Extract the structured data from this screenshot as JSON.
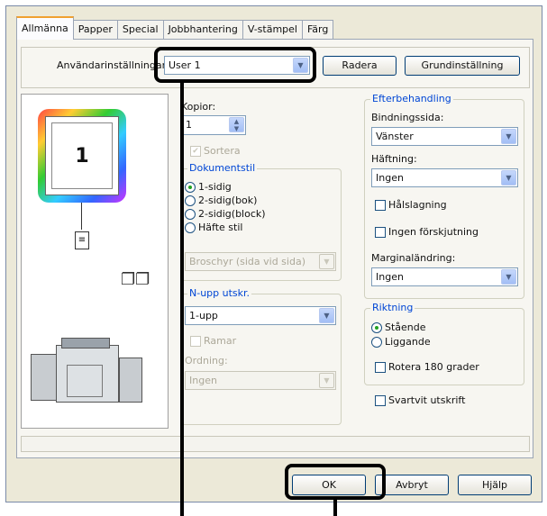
{
  "tabs": [
    "Allmänna",
    "Papper",
    "Special",
    "Jobbhantering",
    "V-stämpel",
    "Färg"
  ],
  "user_settings": {
    "label": "Användarinställningar",
    "value": "User 1",
    "delete_label": "Radera",
    "defaults_label": "Grundinställning"
  },
  "preview": {
    "page_number": "1"
  },
  "copies": {
    "label": "Kopior:",
    "value": "1",
    "collate_label": "Sortera"
  },
  "document_style": {
    "title": "Dokumentstil",
    "options": [
      "1-sidig",
      "2-sidig(bok)",
      "2-sidig(block)",
      "Häfte stil"
    ],
    "selected": "1-sidig",
    "booklet_select": "Broschyr (sida vid sida)"
  },
  "n_up": {
    "title": "N-upp utskr.",
    "value": "1-upp",
    "border_label": "Ramar",
    "order_label": "Ordning:",
    "order_value": "Ingen"
  },
  "finishing": {
    "title": "Efterbehandling",
    "binding_label": "Bindningssida:",
    "binding_value": "Vänster",
    "staple_label": "Häftning:",
    "staple_value": "Ingen",
    "punch_label": "Hålslagning",
    "no_offset_label": "Ingen förskjutning",
    "margin_label": "Marginaländring:",
    "margin_value": "Ingen"
  },
  "orientation": {
    "title": "Riktning",
    "options": [
      "Stående",
      "Liggande"
    ],
    "selected": "Stående",
    "rotate_label": "Rotera 180 grader"
  },
  "bw_print_label": "Svartvit utskrift",
  "footer": {
    "ok_label": "OK",
    "cancel_label": "Avbryt",
    "help_label": "Hjälp"
  }
}
